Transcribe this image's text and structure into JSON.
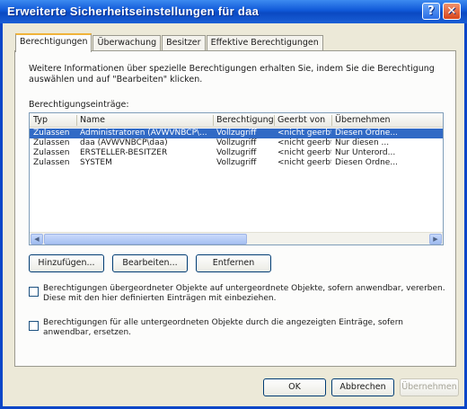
{
  "window": {
    "title": "Erweiterte Sicherheitseinstellungen für daa",
    "help_label": "?",
    "close_label": "✕"
  },
  "tabs": [
    {
      "label": "Berechtigungen",
      "active": true
    },
    {
      "label": "Überwachung"
    },
    {
      "label": "Besitzer"
    },
    {
      "label": "Effektive Berechtigungen"
    }
  ],
  "info_text": "Weitere Informationen über spezielle Berechtigungen erhalten Sie, indem Sie die Berechtigung auswählen und auf \"Bearbeiten\" klicken.",
  "list_label": "Berechtigungseinträge:",
  "columns": [
    "Typ",
    "Name",
    "Berechtigung",
    "Geerbt von",
    "Übernehmen"
  ],
  "rows": [
    {
      "typ": "Zulassen",
      "name": "Administratoren (AVWVNBCP\\...",
      "berechtigung": "Vollzugriff",
      "geerbt": "<nicht geerbt>",
      "uebernehmen": "Diesen Ordne...",
      "selected": true
    },
    {
      "typ": "Zulassen",
      "name": "daa (AVWVNBCP\\daa)",
      "berechtigung": "Vollzugriff",
      "geerbt": "<nicht geerbt>",
      "uebernehmen": "Nur diesen ..."
    },
    {
      "typ": "Zulassen",
      "name": "ERSTELLER-BESITZER",
      "berechtigung": "Vollzugriff",
      "geerbt": "<nicht geerbt>",
      "uebernehmen": "Nur Unterord..."
    },
    {
      "typ": "Zulassen",
      "name": "SYSTEM",
      "berechtigung": "Vollzugriff",
      "geerbt": "<nicht geerbt>",
      "uebernehmen": "Diesen Ordne..."
    }
  ],
  "scroll": {
    "left": "◀",
    "right": "▶"
  },
  "buttons": {
    "add": "Hinzufügen...",
    "edit": "Bearbeiten...",
    "remove": "Entfernen",
    "ok": "OK",
    "cancel": "Abbrechen",
    "apply": "Übernehmen"
  },
  "checks": {
    "inherit": "Berechtigungen übergeordneter Objekte auf untergeordnete Objekte, sofern anwendbar, vererben. Diese mit den hier definierten Einträgen mit einbeziehen.",
    "replace": "Berechtigungen für alle untergeordneten Objekte durch die angezeigten Einträge, sofern anwendbar, ersetzen."
  }
}
